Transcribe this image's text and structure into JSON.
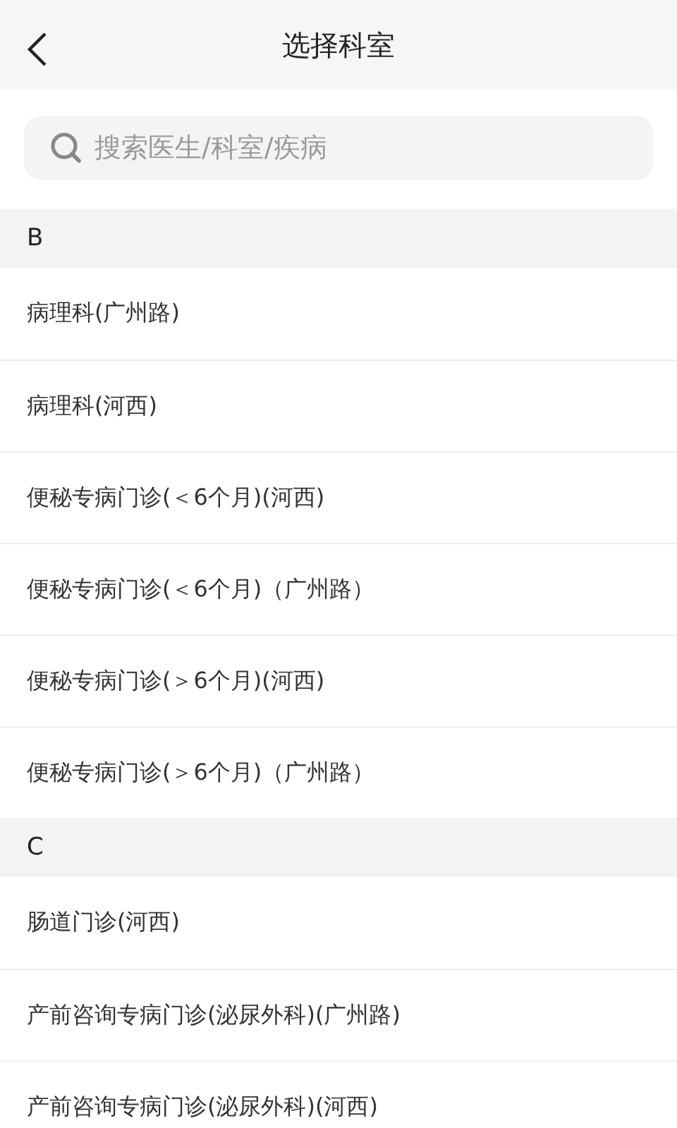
{
  "header": {
    "title": "选择科室"
  },
  "search": {
    "placeholder": "搜索医生/科室/疾病"
  },
  "sections": [
    {
      "letter": "B",
      "items": [
        {
          "name": "病理科(广州路)"
        },
        {
          "name": "病理科(河西)"
        },
        {
          "name": "便秘专病门诊(＜6个月)(河西)"
        },
        {
          "name": "便秘专病门诊(＜6个月)（广州路）"
        },
        {
          "name": "便秘专病门诊(＞6个月)(河西)"
        },
        {
          "name": "便秘专病门诊(＞6个月)（广州路）"
        }
      ]
    },
    {
      "letter": "C",
      "items": [
        {
          "name": "肠道门诊(河西)"
        },
        {
          "name": "产前咨询专病门诊(泌尿外科)(广州路)"
        },
        {
          "name": "产前咨询专病门诊(泌尿外科)(河西)"
        }
      ]
    }
  ]
}
